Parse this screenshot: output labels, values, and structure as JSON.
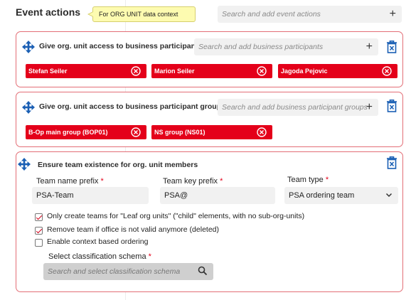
{
  "header": {
    "title": "Event actions",
    "tooltip": "For ORG UNIT data context",
    "search_placeholder": "Search and add event actions"
  },
  "cards": [
    {
      "title": "Give org. unit access to business participants",
      "search_placeholder": "Search and add business participants",
      "chips": [
        "Stefan Seiler",
        "Marion Seiler",
        "Jagoda Pejovic"
      ]
    },
    {
      "title": "Give org. unit access to business participant groups",
      "search_placeholder": "Search and add business participant groups",
      "chips": [
        "B-Op main group (BOP01)",
        "NS group (NS01)"
      ]
    },
    {
      "title": "Ensure team existence for org. unit members",
      "fields": [
        {
          "label": "Team name prefix",
          "value": "PSA-Team"
        },
        {
          "label": "Team key prefix",
          "value": "PSA@"
        },
        {
          "label": "Team type",
          "value": "PSA ordering team"
        }
      ],
      "checkboxes": [
        {
          "label": "Only create teams for \"Leaf org units\" (\"child\" elements, with no sub-org-units)",
          "checked": true
        },
        {
          "label": "Remove team if office is not valid anymore (deleted)",
          "checked": true
        },
        {
          "label": "Enable context based ordering",
          "checked": false
        }
      ],
      "schema_label": "Select classification schema",
      "schema_placeholder": "Search and select classification schema"
    }
  ],
  "required_mark": "*",
  "icons": {
    "move": "move-arrows-icon",
    "trash": "trash-icon",
    "chip_remove": "remove-circle-icon",
    "plus": "plus-icon",
    "search": "magnifier-icon",
    "chevron": "chevron-down-icon"
  },
  "colors": {
    "accent": "#e4001a",
    "card_border": "#e36e76",
    "icon_blue": "#1a5fb4"
  }
}
